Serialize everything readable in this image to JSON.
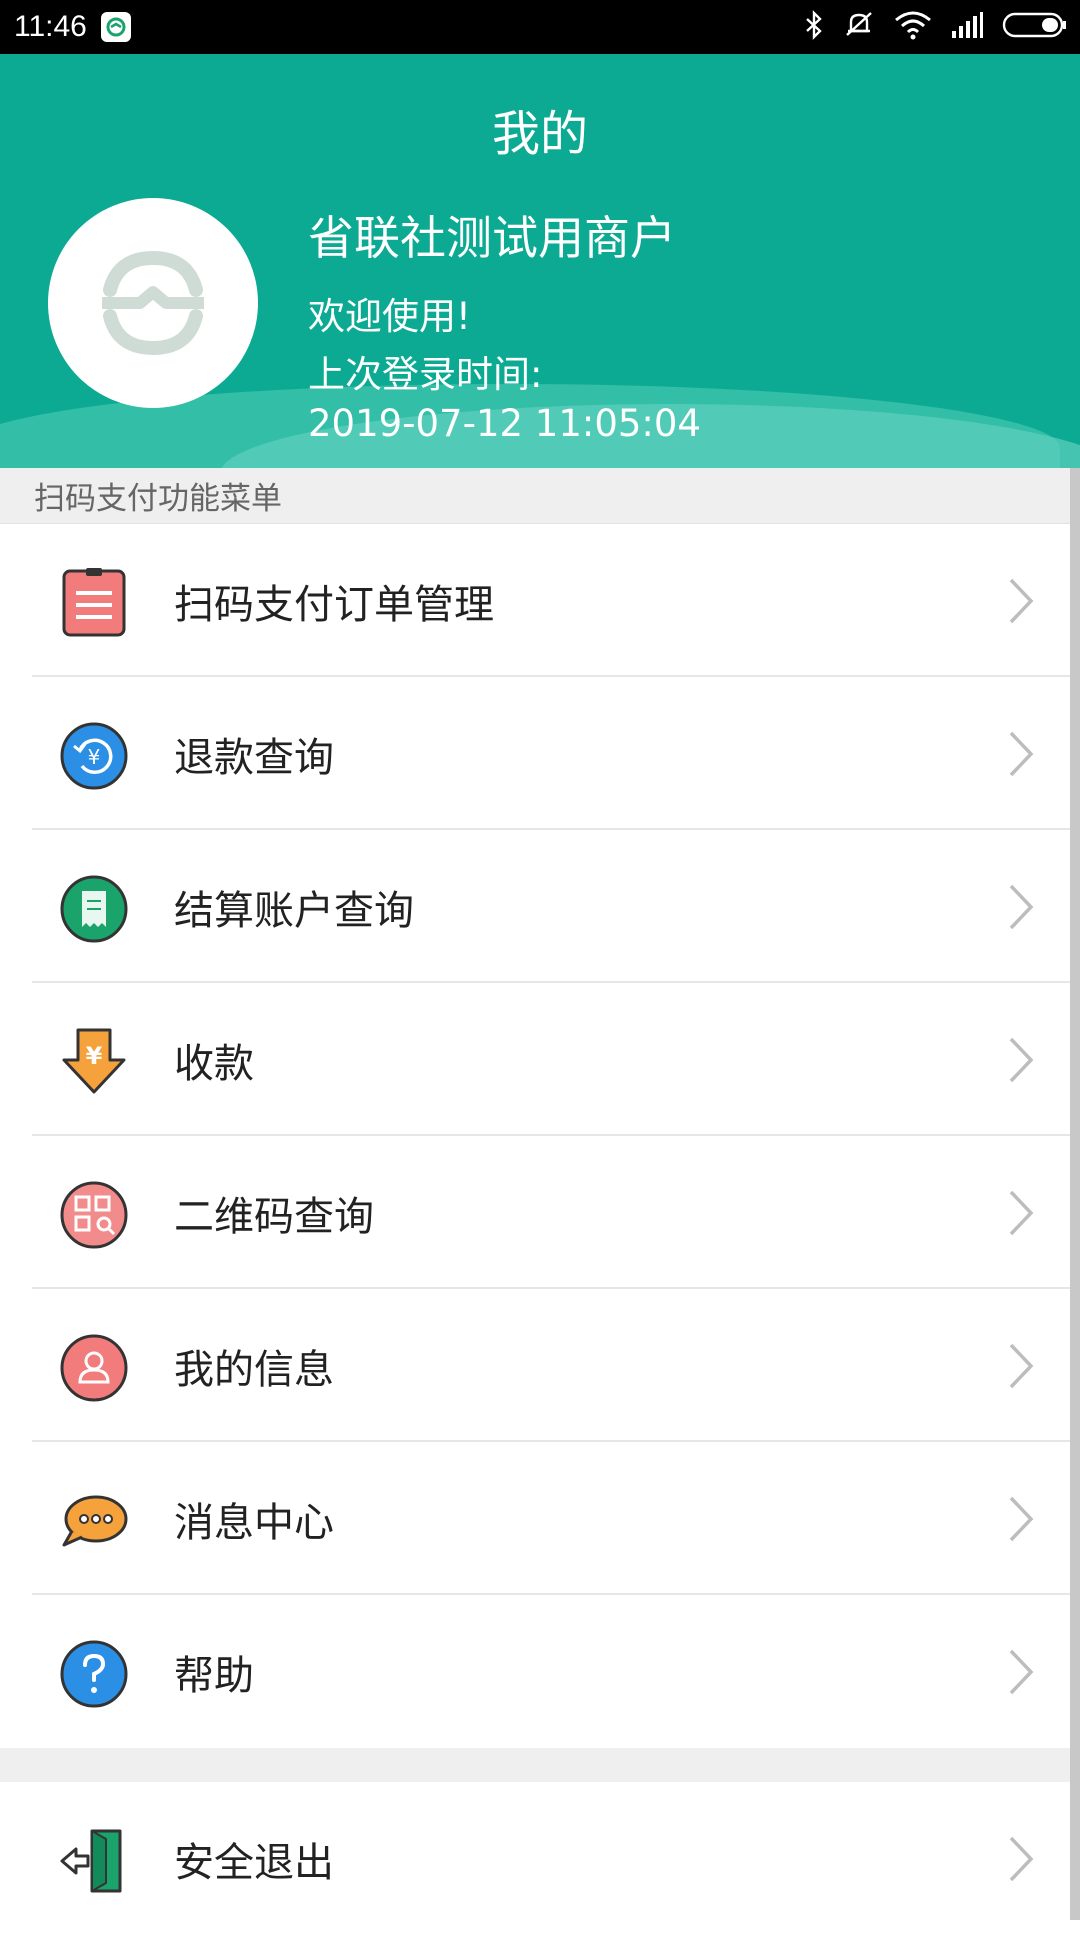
{
  "status_bar": {
    "time": "11:46"
  },
  "header": {
    "title": "我的",
    "merchant_name": "省联社测试用商户",
    "welcome": "欢迎使用!",
    "last_login_label": "上次登录时间:",
    "last_login_time": "2019-07-12 11:05:04"
  },
  "section_label": "扫码支付功能菜单",
  "menu": {
    "items": [
      {
        "label": "扫码支付订单管理",
        "icon": "clipboard-icon"
      },
      {
        "label": "退款查询",
        "icon": "refund-icon"
      },
      {
        "label": "结算账户查询",
        "icon": "receipt-icon"
      },
      {
        "label": "收款",
        "icon": "collect-money-icon"
      },
      {
        "label": "二维码查询",
        "icon": "qr-search-icon"
      },
      {
        "label": "我的信息",
        "icon": "user-icon"
      },
      {
        "label": "消息中心",
        "icon": "message-icon"
      },
      {
        "label": "帮助",
        "icon": "help-icon"
      }
    ],
    "logout": {
      "label": "安全退出",
      "icon": "exit-icon"
    }
  },
  "colors": {
    "header_bg": "#0daa93",
    "section_bg": "#efefef"
  }
}
